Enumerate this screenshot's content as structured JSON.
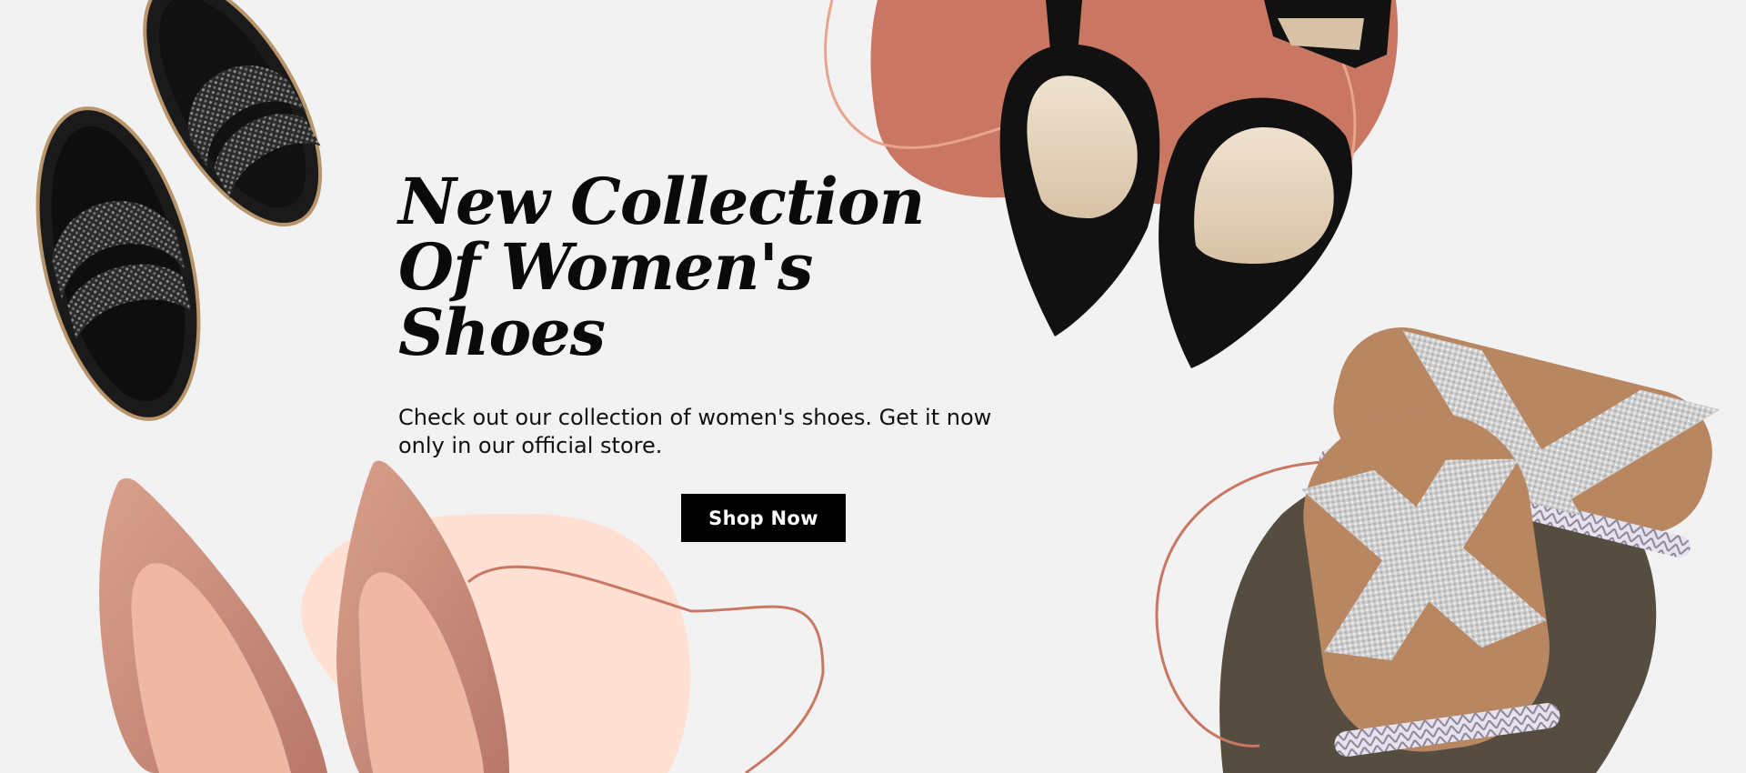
{
  "hero": {
    "headline_lines": [
      "New Collection",
      "Of Women's",
      "Shoes"
    ],
    "subtext_lines": [
      "Check out our collection of women's shoes. Get it now",
      "only in our official store."
    ],
    "cta_label": "Shop Now"
  },
  "colors": {
    "background": "#f2f2f2",
    "terracotta": "#c97762",
    "peach": "#ffe0d3",
    "dark_brown": "#564d41",
    "cta_bg": "#000000",
    "cta_text": "#ffffff"
  },
  "products": [
    {
      "name": "black-rhinestone-slide-sandals"
    },
    {
      "name": "black-pointed-pumps"
    },
    {
      "name": "pink-suede-pointed-flats"
    },
    {
      "name": "silver-cross-strap-sandals"
    }
  ]
}
